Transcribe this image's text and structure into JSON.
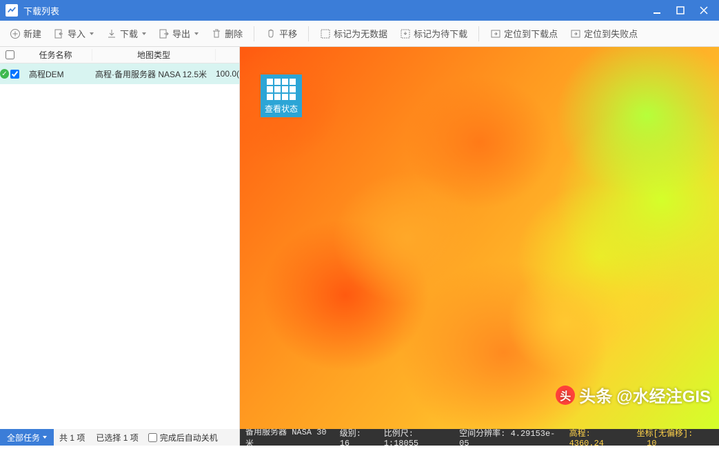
{
  "window": {
    "title": "下载列表"
  },
  "toolbar": {
    "new": "新建",
    "import": "导入",
    "download": "下载",
    "export": "导出",
    "delete": "删除",
    "pan": "平移",
    "mark_nodata": "标记为无数据",
    "mark_pending": "标记为待下载",
    "locate_download": "定位到下载点",
    "locate_fail": "定位到失败点"
  },
  "list": {
    "header": {
      "name": "任务名称",
      "maptype": "地图类型"
    },
    "row": {
      "name": "高程DEM",
      "maptype": "高程·备用服务器 NASA 12.5米",
      "progress": "100.0("
    }
  },
  "overlay": {
    "view_status": "查看状态"
  },
  "watermark": {
    "prefix": "头条",
    "at": "@水经注GIS"
  },
  "footer": {
    "all_tasks": "全部任务",
    "count": "共 1 项",
    "selected": "已选择 1 项",
    "auto_shutdown": "完成后自动关机",
    "status": {
      "server": "备用服务器 NASA 30米",
      "level_label": "级别:",
      "level": "16",
      "scale_label": "比例尺:",
      "scale": "1:18055",
      "res_label": "空间分辨率:",
      "res": "4.29153e-05",
      "elev_label": "高程:",
      "elev": "4360.24",
      "coord_label": "坐标[无偏移]:",
      "coord": "10"
    }
  }
}
